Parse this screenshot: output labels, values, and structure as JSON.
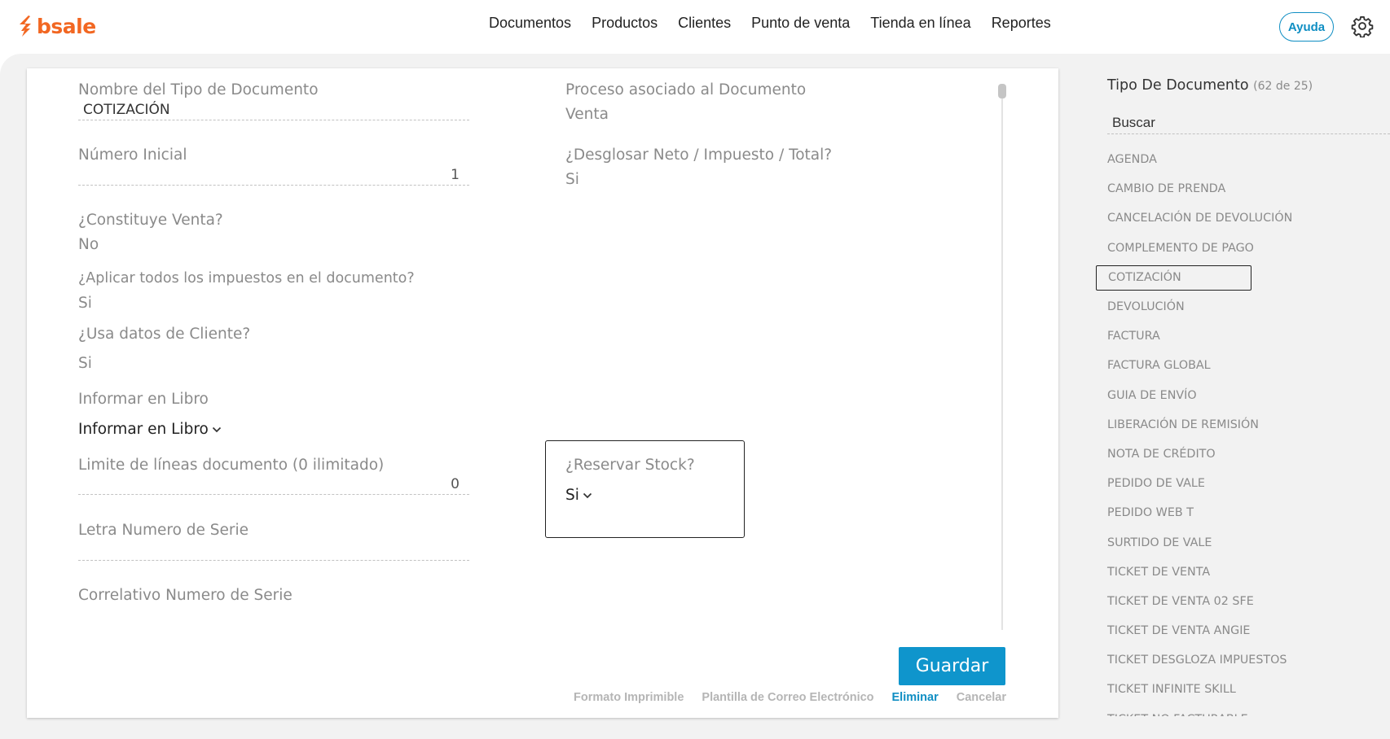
{
  "app": {
    "logo_text": "bsale",
    "brand_color": "#f26722",
    "accent_color": "#0f95cc"
  },
  "nav": {
    "items": [
      "Documentos",
      "Productos",
      "Clientes",
      "Punto de venta",
      "Tienda en línea",
      "Reportes"
    ],
    "help_label": "Ayuda",
    "settings_icon": "gear-icon"
  },
  "form": {
    "doc_type_name": {
      "label": "Nombre del Tipo de Documento",
      "value": "COTIZACIÓN"
    },
    "initial_number": {
      "label": "Número Inicial",
      "value": "1"
    },
    "constitutes_sale": {
      "label": "¿Constituye Venta?",
      "value": "No"
    },
    "apply_all_taxes": {
      "label": "¿Aplicar todos los impuestos en el documento?",
      "value": "Si"
    },
    "uses_client_data": {
      "label": "¿Usa datos de Cliente?",
      "value": "Si"
    },
    "report_in_book": {
      "label": "Informar en Libro",
      "value": "Informar en Libro"
    },
    "line_limit": {
      "label": "Limite de líneas documento (0 ilimitado)",
      "value": "0"
    },
    "serial_letter": {
      "label": "Letra Numero de Serie",
      "value": ""
    },
    "serial_correlative": {
      "label": "Correlativo Numero de Serie"
    },
    "process": {
      "label": "Proceso asociado al Documento",
      "value": "Venta"
    },
    "breakdown": {
      "label": "¿Desglosar Neto / Impuesto / Total?",
      "value": "Si"
    },
    "reserve_stock": {
      "label": "¿Reservar Stock?",
      "value": "Si"
    }
  },
  "actions": {
    "save": "Guardar",
    "printable_format": "Formato Imprimible",
    "email_template": "Plantilla de Correo Electrónico",
    "delete": "Eliminar",
    "cancel": "Cancelar"
  },
  "sidebar": {
    "title": "Tipo De Documento",
    "count": "(62 de 25)",
    "search_placeholder": "Buscar",
    "selected": "COTIZACIÓN",
    "items": [
      "AGENDA",
      "CAMBIO DE PRENDA",
      "CANCELACIÓN DE DEVOLUCIÓN",
      "COMPLEMENTO DE PAGO",
      "COTIZACIÓN",
      "DEVOLUCIÓN",
      "FACTURA",
      "FACTURA GLOBAL",
      "GUIA DE ENVÍO",
      "LIBERACIÓN DE REMISIÓN",
      "NOTA DE CRÉDITO",
      "PEDIDO DE VALE",
      "PEDIDO WEB T",
      "SURTIDO DE VALE",
      "TICKET DE VENTA",
      "TICKET DE VENTA 02 SFE",
      "TICKET DE VENTA ANGIE",
      "TICKET DESGLOZA IMPUESTOS",
      "TICKET INFINITE SKILL",
      "TICKET NO FACTURABLE"
    ]
  }
}
